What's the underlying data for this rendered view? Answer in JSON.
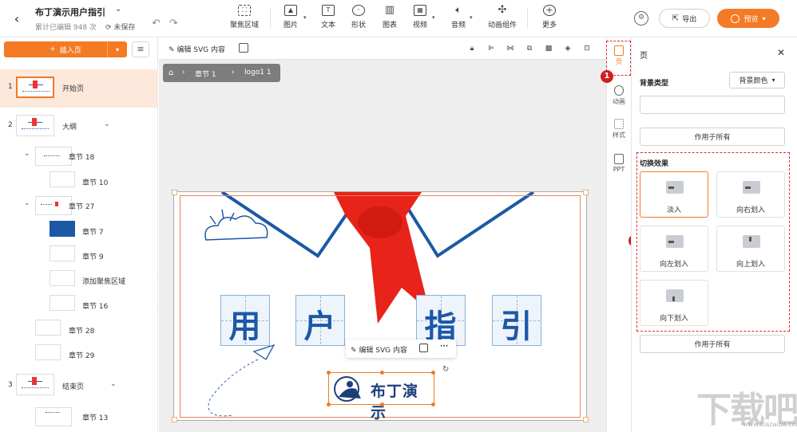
{
  "header": {
    "title": "布丁演示用户指引",
    "subtitle": "累计已编辑 948 次",
    "save_status": "未保存",
    "tools": [
      {
        "label": "聚焦区域",
        "icon": "focus-icon"
      },
      {
        "label": "图片",
        "icon": "image-icon"
      },
      {
        "label": "文本",
        "icon": "text-icon"
      },
      {
        "label": "形状",
        "icon": "shape-icon"
      },
      {
        "label": "图表",
        "icon": "chart-icon"
      },
      {
        "label": "视频",
        "icon": "video-icon"
      },
      {
        "label": "音频",
        "icon": "audio-icon"
      },
      {
        "label": "动画组件",
        "icon": "animation-component-icon"
      },
      {
        "label": "更多",
        "icon": "more-icon"
      }
    ],
    "export_label": "导出",
    "preview_label": "预览"
  },
  "left_panel": {
    "insert_label": "插入页",
    "pages": [
      {
        "num": "1",
        "label": "开始页"
      },
      {
        "num": "2",
        "label": "大纲"
      },
      {
        "num": "",
        "label": "章节 18"
      },
      {
        "num": "",
        "label": "章节 10"
      },
      {
        "num": "",
        "label": "章节 27"
      },
      {
        "num": "",
        "label": "章节 7"
      },
      {
        "num": "",
        "label": "章节 9"
      },
      {
        "num": "",
        "label": "添加聚焦区域"
      },
      {
        "num": "",
        "label": "章节 16"
      },
      {
        "num": "",
        "label": "章节 28"
      },
      {
        "num": "",
        "label": "章节 29"
      },
      {
        "num": "3",
        "label": "结束页"
      },
      {
        "num": "",
        "label": "章节 13"
      }
    ]
  },
  "canvas": {
    "edit_svg_label": "编辑 SVG 内容",
    "breadcrumb": [
      "章节 1",
      "logo1 1"
    ],
    "slide_chars": [
      "用",
      "户",
      "指",
      "引"
    ],
    "float_edit_label": "编辑 SVG 内容",
    "float_more": "···",
    "logo_text": "布丁演示"
  },
  "side_icons": [
    {
      "label": "页",
      "icon": "page-icon"
    },
    {
      "label": "动画",
      "icon": "animation-icon"
    },
    {
      "label": "样式",
      "icon": "style-icon"
    },
    {
      "label": "PPT",
      "icon": "ppt-icon"
    }
  ],
  "badges": [
    "1",
    "2"
  ],
  "right_panel": {
    "title": "页",
    "bg_type_label": "背景类型",
    "bg_select_value": "背景颜色",
    "apply_all_label": "作用于所有",
    "transition_label": "切换效果",
    "transitions": [
      "淡入",
      "向右划入",
      "向左划入",
      "向上划入",
      "向下划入"
    ],
    "apply_all_label_2": "作用于所有"
  },
  "watermark": "下载吧",
  "watermark_url": "www.xiazaiba.com",
  "colors": {
    "accent": "#f47a24",
    "annotation_red": "#e0282a",
    "slide_blue": "#1c58a6",
    "scarf_red": "#e8231a"
  }
}
